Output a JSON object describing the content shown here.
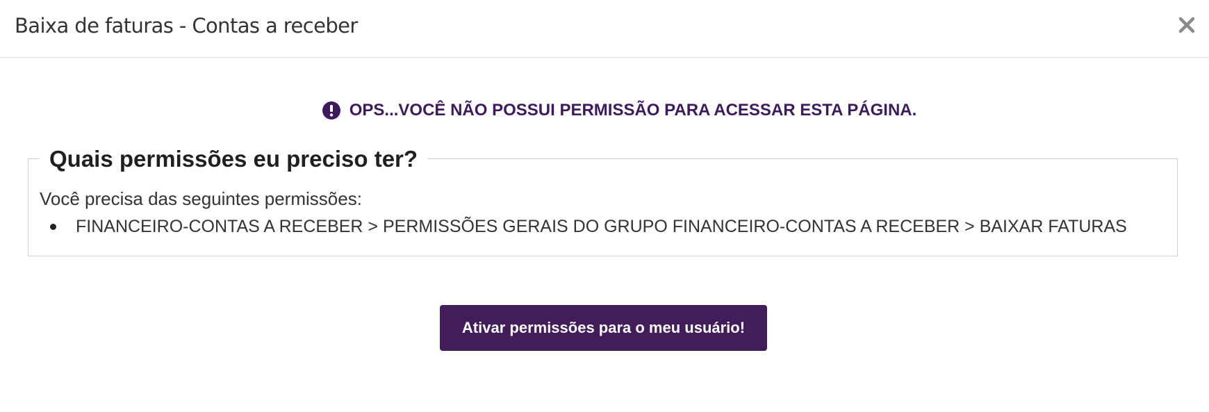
{
  "modal": {
    "title": "Baixa de faturas - Contas a receber",
    "close_icon": "close-icon"
  },
  "alert": {
    "icon": "exclamation-circle-icon",
    "message": "OPS...VOCÊ NÃO POSSUI PERMISSÃO PARA ACESSAR ESTA PÁGINA.",
    "color": "#3d1a5b"
  },
  "permissions": {
    "legend": "Quais permissões eu preciso ter?",
    "intro": "Você precisa das seguintes permissões:",
    "items": [
      "FINANCEIRO-CONTAS A RECEBER > PERMISSÕES GERAIS DO GRUPO FINANCEIRO-CONTAS A RECEBER > BAIXAR FATURAS"
    ]
  },
  "actions": {
    "activate_label": "Ativar permissões para o meu usuário!",
    "accent_color": "#421d59"
  }
}
